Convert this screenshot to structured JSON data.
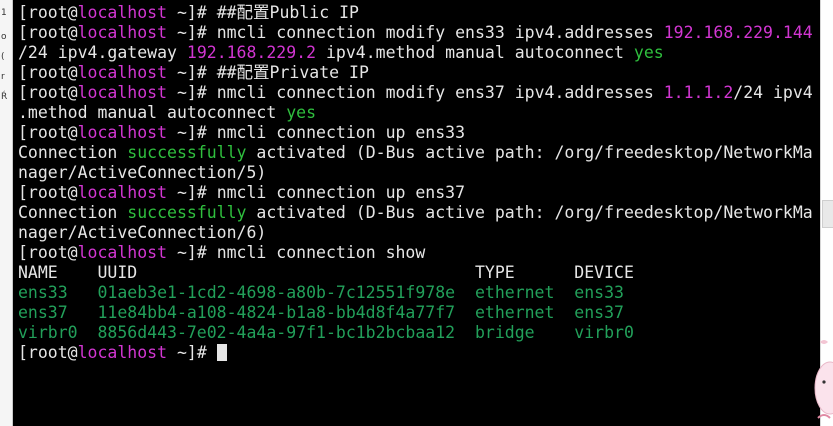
{
  "gutter": [
    "1",
    "o",
    "(",
    "r",
    "Ŕ"
  ],
  "prompt": {
    "user": "[root@",
    "host": "localhost",
    "path": " ~]# "
  },
  "lines": [
    {
      "type": "cmd",
      "text": "##配置Public IP"
    },
    {
      "type": "cmd",
      "parts": [
        {
          "t": "nmcli connection modify ens33 ipv4.addresses "
        },
        {
          "t": "192.168.229.144",
          "c": "num"
        }
      ]
    },
    {
      "type": "out",
      "parts": [
        {
          "t": "/24 ipv4.gateway "
        },
        {
          "t": "192.168.229.2",
          "c": "num"
        },
        {
          "t": " ipv4.method manual autoconnect "
        },
        {
          "t": "yes",
          "c": "yes"
        }
      ]
    },
    {
      "type": "cmd",
      "text": "##配置Private IP"
    },
    {
      "type": "cmd",
      "parts": [
        {
          "t": "nmcli connection modify ens37 ipv4.addresses "
        },
        {
          "t": "1.1.1.2",
          "c": "num"
        },
        {
          "t": "/24 ipv4"
        }
      ]
    },
    {
      "type": "out",
      "parts": [
        {
          "t": ".method manual autoconnect "
        },
        {
          "t": "yes",
          "c": "yes"
        }
      ]
    },
    {
      "type": "cmd",
      "text": "nmcli connection up ens33"
    },
    {
      "type": "out",
      "parts": [
        {
          "t": "Connection "
        },
        {
          "t": "successfully",
          "c": "green"
        },
        {
          "t": " activated (D-Bus active path: /org/freedesktop/NetworkMa"
        }
      ]
    },
    {
      "type": "out",
      "parts": [
        {
          "t": "nager/ActiveConnection/5)"
        }
      ]
    },
    {
      "type": "cmd",
      "text": "nmcli connection up ens37"
    },
    {
      "type": "out",
      "parts": [
        {
          "t": "Connection "
        },
        {
          "t": "successfully",
          "c": "green"
        },
        {
          "t": " activated (D-Bus active path: /org/freedesktop/NetworkMa"
        }
      ]
    },
    {
      "type": "out",
      "parts": [
        {
          "t": "nager/ActiveConnection/6)"
        }
      ]
    },
    {
      "type": "cmd",
      "text": "nmcli connection show"
    },
    {
      "type": "out",
      "parts": [
        {
          "t": "NAME    UUID                                  TYPE      DEVICE"
        }
      ]
    },
    {
      "type": "out",
      "parts": [
        {
          "t": "ens33   01aeb3e1-1cd2-4698-a80b-7c12551f978e  ethernet  ens33",
          "c": "conn"
        }
      ]
    },
    {
      "type": "out",
      "parts": [
        {
          "t": "ens37   11e84bb4-a108-4824-b1a8-bb4d8f4a77f7  ethernet  ens37",
          "c": "conn"
        }
      ]
    },
    {
      "type": "out",
      "parts": [
        {
          "t": "virbr0  8856d443-7e02-4a4a-97f1-bc1b2bcbaa12  bridge    virbr0",
          "c": "conn"
        }
      ]
    },
    {
      "type": "cmd",
      "text": "",
      "cursor": true
    }
  ],
  "colors": {
    "background": "#000000",
    "foreground": "#e6e6e6",
    "host": "#d236d2",
    "success": "#2fbf3e",
    "connection_row": "#22a05a"
  }
}
